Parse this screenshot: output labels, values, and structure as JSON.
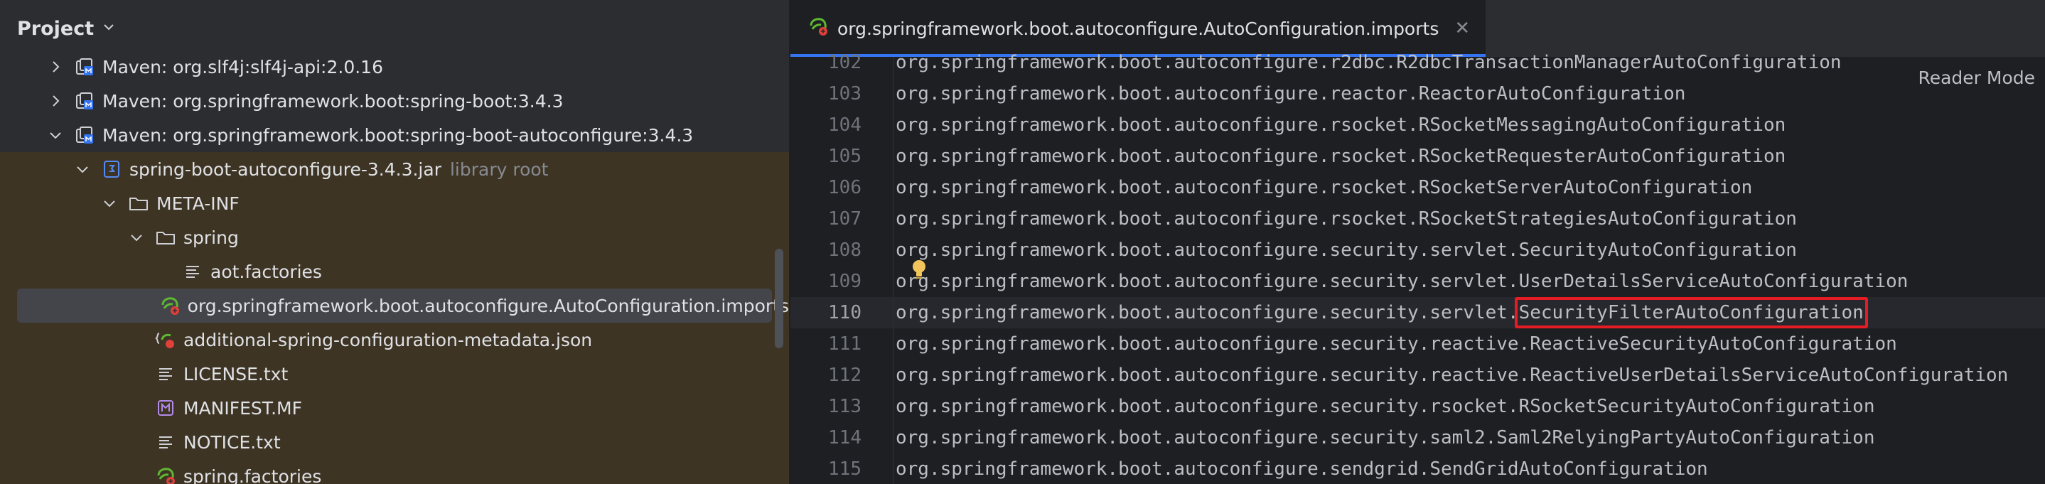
{
  "project_panel": {
    "title": "Project",
    "tree": [
      {
        "indent": 0,
        "chevron": "right",
        "icon": "maven-library-icon",
        "label": "Maven: org.slf4j:slf4j-api:2.0.16",
        "hint": "",
        "lib": false,
        "selected": false
      },
      {
        "indent": 0,
        "chevron": "right",
        "icon": "maven-library-icon",
        "label": "Maven: org.springframework.boot:spring-boot:3.4.3",
        "hint": "",
        "lib": false,
        "selected": false
      },
      {
        "indent": 0,
        "chevron": "down",
        "icon": "maven-library-icon",
        "label": "Maven: org.springframework.boot:spring-boot-autoconfigure:3.4.3",
        "hint": "",
        "lib": false,
        "selected": false
      },
      {
        "indent": 1,
        "chevron": "down",
        "icon": "jar-icon",
        "label": "spring-boot-autoconfigure-3.4.3.jar",
        "hint": "library root",
        "lib": true,
        "selected": false
      },
      {
        "indent": 2,
        "chevron": "down",
        "icon": "folder-icon",
        "label": "META-INF",
        "hint": "",
        "lib": true,
        "selected": false
      },
      {
        "indent": 3,
        "chevron": "down",
        "icon": "folder-icon",
        "label": "spring",
        "hint": "",
        "lib": true,
        "selected": false
      },
      {
        "indent": 4,
        "chevron": "none",
        "icon": "text-file-icon",
        "label": "aot.factories",
        "hint": "",
        "lib": true,
        "selected": false
      },
      {
        "indent": 4,
        "chevron": "none",
        "icon": "spring-file-icon",
        "label": "org.springframework.boot.autoconfigure.AutoConfiguration.imports",
        "hint": "",
        "lib": true,
        "selected": true
      },
      {
        "indent": 3,
        "chevron": "none",
        "icon": "spring-json-icon",
        "label": "additional-spring-configuration-metadata.json",
        "hint": "",
        "lib": true,
        "selected": false
      },
      {
        "indent": 3,
        "chevron": "none",
        "icon": "text-file-icon",
        "label": "LICENSE.txt",
        "hint": "",
        "lib": true,
        "selected": false
      },
      {
        "indent": 3,
        "chevron": "none",
        "icon": "manifest-icon",
        "label": "MANIFEST.MF",
        "hint": "",
        "lib": true,
        "selected": false
      },
      {
        "indent": 3,
        "chevron": "none",
        "icon": "text-file-icon",
        "label": "NOTICE.txt",
        "hint": "",
        "lib": true,
        "selected": false
      },
      {
        "indent": 3,
        "chevron": "none",
        "icon": "spring-file-icon",
        "label": "spring.factories",
        "hint": "",
        "lib": true,
        "selected": false
      }
    ]
  },
  "editor": {
    "tab_title": "org.springframework.boot.autoconfigure.AutoConfiguration.imports",
    "reader_mode": "Reader Mode",
    "current_line": "110",
    "highlighted_text": "SecurityFilterAutoConfiguration",
    "lines": [
      {
        "n": "102",
        "text": "org.springframework.boot.autoconfigure.r2dbc.R2dbcTransactionManagerAutoConfiguration"
      },
      {
        "n": "103",
        "text": "org.springframework.boot.autoconfigure.reactor.ReactorAutoConfiguration"
      },
      {
        "n": "104",
        "text": "org.springframework.boot.autoconfigure.rsocket.RSocketMessagingAutoConfiguration"
      },
      {
        "n": "105",
        "text": "org.springframework.boot.autoconfigure.rsocket.RSocketRequesterAutoConfiguration"
      },
      {
        "n": "106",
        "text": "org.springframework.boot.autoconfigure.rsocket.RSocketServerAutoConfiguration"
      },
      {
        "n": "107",
        "text": "org.springframework.boot.autoconfigure.rsocket.RSocketStrategiesAutoConfiguration"
      },
      {
        "n": "108",
        "text": "org.springframework.boot.autoconfigure.security.servlet.SecurityAutoConfiguration"
      },
      {
        "n": "109",
        "text": "org.springframework.boot.autoconfigure.security.servlet.UserDetailsServiceAutoConfiguration"
      },
      {
        "n": "110",
        "text": "org.springframework.boot.autoconfigure.security.servlet.SecurityFilterAutoConfiguration"
      },
      {
        "n": "111",
        "text": "org.springframework.boot.autoconfigure.security.reactive.ReactiveSecurityAutoConfiguration"
      },
      {
        "n": "112",
        "text": "org.springframework.boot.autoconfigure.security.reactive.ReactiveUserDetailsServiceAutoConfiguration"
      },
      {
        "n": "113",
        "text": "org.springframework.boot.autoconfigure.security.rsocket.RSocketSecurityAutoConfiguration"
      },
      {
        "n": "114",
        "text": "org.springframework.boot.autoconfigure.security.saml2.Saml2RelyingPartyAutoConfiguration"
      },
      {
        "n": "115",
        "text": "org.springframework.boot.autoconfigure.sendgrid.SendGridAutoConfiguration"
      }
    ]
  },
  "colors": {
    "library_row_bg": "#3e3424",
    "selection_bg": "#43454a",
    "highlight_border": "#e51c23",
    "tab_underline": "#3574f0"
  }
}
